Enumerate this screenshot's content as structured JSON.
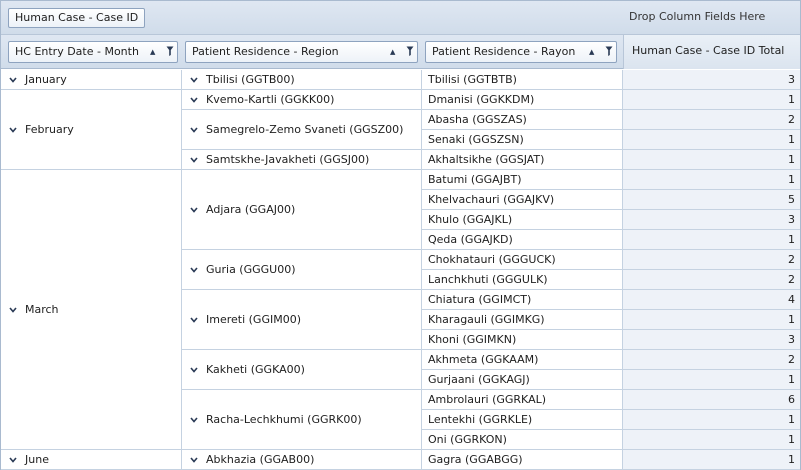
{
  "filter_area": {
    "field_label": "Human Case - Case ID",
    "drop_column_text": "Drop Column Fields Here"
  },
  "row_fields": [
    {
      "label": "HC Entry Date - Month"
    },
    {
      "label": "Patient Residence - Region"
    },
    {
      "label": "Patient Residence - Rayon"
    }
  ],
  "data_header": "Human Case - Case ID Total",
  "months": [
    {
      "label": "January",
      "row_start": 0,
      "row_span": 1
    },
    {
      "label": "February",
      "row_start": 1,
      "row_span": 4
    },
    {
      "label": "March",
      "row_start": 5,
      "row_span": 14
    },
    {
      "label": "June",
      "row_start": 19,
      "row_span": 1
    }
  ],
  "regions": [
    {
      "label": "Tbilisi (GGTB00)",
      "row_start": 0,
      "row_span": 1
    },
    {
      "label": "Kvemo-Kartli (GGKK00)",
      "row_start": 1,
      "row_span": 1
    },
    {
      "label": "Samegrelo-Zemo Svaneti (GGSZ00)",
      "row_start": 2,
      "row_span": 2
    },
    {
      "label": "Samtskhe-Javakheti (GGSJ00)",
      "row_start": 4,
      "row_span": 1
    },
    {
      "label": "Adjara (GGAJ00)",
      "row_start": 5,
      "row_span": 4
    },
    {
      "label": "Guria (GGGU00)",
      "row_start": 9,
      "row_span": 2
    },
    {
      "label": "Imereti (GGIM00)",
      "row_start": 11,
      "row_span": 3
    },
    {
      "label": "Kakheti (GGKA00)",
      "row_start": 14,
      "row_span": 2
    },
    {
      "label": "Racha-Lechkhumi (GGRK00)",
      "row_start": 16,
      "row_span": 3
    },
    {
      "label": "Abkhazia (GGAB00)",
      "row_start": 19,
      "row_span": 1
    }
  ],
  "rayons": [
    {
      "label": "Tbilisi (GGTBTB)",
      "value": "3"
    },
    {
      "label": "Dmanisi (GGKKDM)",
      "value": "1"
    },
    {
      "label": "Abasha (GGSZAS)",
      "value": "2"
    },
    {
      "label": "Senaki (GGSZSN)",
      "value": "1"
    },
    {
      "label": "Akhaltsikhe (GGSJAT)",
      "value": "1"
    },
    {
      "label": "Batumi (GGAJBT)",
      "value": "1"
    },
    {
      "label": "Khelvachauri (GGAJKV)",
      "value": "5"
    },
    {
      "label": "Khulo (GGAJKL)",
      "value": "3"
    },
    {
      "label": "Qeda (GGAJKD)",
      "value": "1"
    },
    {
      "label": "Chokhatauri (GGGUCK)",
      "value": "2"
    },
    {
      "label": "Lanchkhuti (GGGULK)",
      "value": "2"
    },
    {
      "label": "Chiatura (GGIMCT)",
      "value": "4"
    },
    {
      "label": "Kharagauli (GGIMKG)",
      "value": "1"
    },
    {
      "label": "Khoni (GGIMKN)",
      "value": "3"
    },
    {
      "label": "Akhmeta (GGKAAM)",
      "value": "2"
    },
    {
      "label": "Gurjaani (GGKAGJ)",
      "value": "1"
    },
    {
      "label": "Ambrolauri (GGRKAL)",
      "value": "6"
    },
    {
      "label": "Lentekhi (GGRKLE)",
      "value": "1"
    },
    {
      "label": "Oni (GGRKON)",
      "value": "1"
    },
    {
      "label": "Gagra (GGABGG)",
      "value": "1"
    }
  ]
}
